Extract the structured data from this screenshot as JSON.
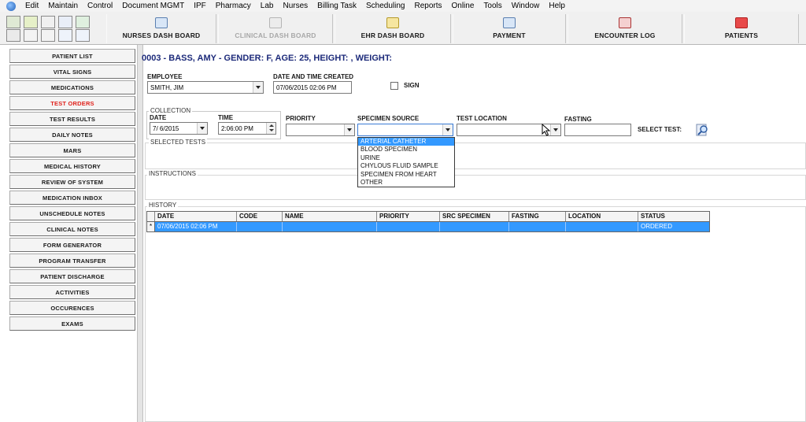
{
  "menu": [
    "Edit",
    "Maintain",
    "Control",
    "Document MGMT",
    "IPF",
    "Pharmacy",
    "Lab",
    "Nurses",
    "Billing Task",
    "Scheduling",
    "Reports",
    "Online",
    "Tools",
    "Window",
    "Help"
  ],
  "toolbar": {
    "buttons": [
      {
        "label": "NURSES DASH BOARD",
        "icon": "monitor-icon",
        "enabled": true
      },
      {
        "label": "CLINICAL DASH BOARD",
        "icon": "clipboard-icon",
        "enabled": false
      },
      {
        "label": "EHR DASH BOARD",
        "icon": "folder-arrow-icon",
        "enabled": true
      },
      {
        "label": "PAYMENT",
        "icon": "magnifier-document-icon",
        "enabled": true
      },
      {
        "label": "ENCOUNTER LOG",
        "icon": "log-arrow-icon",
        "enabled": true
      },
      {
        "label": "PATIENTS",
        "icon": "patients-card-icon",
        "enabled": true
      }
    ]
  },
  "sidebar": {
    "items": [
      {
        "label": "PATIENT LIST"
      },
      {
        "label": "VITAL SIGNS"
      },
      {
        "label": "MEDICATIONS"
      },
      {
        "label": "TEST ORDERS",
        "active": true
      },
      {
        "label": "TEST RESULTS"
      },
      {
        "label": "DAILY NOTES"
      },
      {
        "label": "MARS"
      },
      {
        "label": "MEDICAL HISTORY"
      },
      {
        "label": "REVIEW OF SYSTEM"
      },
      {
        "label": "MEDICATION INBOX"
      },
      {
        "label": "UNSCHEDULE NOTES"
      },
      {
        "label": "CLINICAL NOTES"
      },
      {
        "label": "FORM GENERATOR"
      },
      {
        "label": "PROGRAM TRANSFER"
      },
      {
        "label": "PATIENT DISCHARGE"
      },
      {
        "label": "ACTIVITIES"
      },
      {
        "label": "OCCURENCES"
      },
      {
        "label": "EXAMS"
      }
    ]
  },
  "patient_header": "0003 - BASS, AMY - GENDER: F, AGE: 25, HEIGHT: , WEIGHT:",
  "form": {
    "employee_label": "EMPLOYEE",
    "employee_value": "SMITH, JIM",
    "created_label": "DATE AND TIME CREATED",
    "created_value": "07/06/2015 02:06 PM",
    "sign_label": "SIGN",
    "collection_label": "COLLECTION",
    "date_label": "DATE",
    "date_value": "7/  6/2015",
    "time_label": "TIME",
    "time_value": "2:06:00 PM",
    "priority_label": "PRIORITY",
    "priority_value": "",
    "specimen_label": "SPECIMEN SOURCE",
    "specimen_value": "",
    "location_label": "TEST LOCATION",
    "location_value": "",
    "fasting_label": "FASTING",
    "fasting_value": "",
    "select_test_label": "SELECT TEST:",
    "selected_tests_label": "SELECTED TESTS",
    "instructions_label": "INSTRUCTIONS",
    "history_label": "HISTORY"
  },
  "specimen_options": [
    "ARTERIAL CATHETER",
    "BLOOD SPECIMEN",
    "URINE",
    "CHYLOUS FLUID SAMPLE",
    "SPECIMEN FROM HEART",
    "OTHER"
  ],
  "history": {
    "columns": [
      "DATE",
      "CODE",
      "NAME",
      "PRIORITY",
      "SRC SPECIMEN",
      "FASTING",
      "LOCATION",
      "STATUS"
    ],
    "rows": [
      {
        "marker": "*",
        "date": "07/06/2015 02:06 PM",
        "code": "",
        "name": "",
        "priority": "",
        "src": "",
        "fasting": "",
        "location": "",
        "status": "ORDERED"
      }
    ]
  },
  "colors": {
    "title": "#1c2a7a",
    "active_nav": "#e0231d",
    "selection": "#3399ff"
  }
}
